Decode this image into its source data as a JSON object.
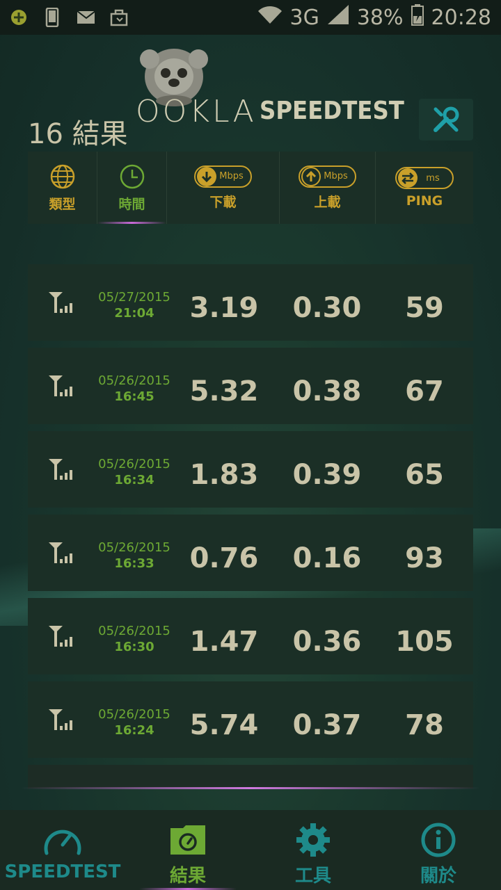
{
  "status_bar": {
    "network": "3G",
    "battery": "38%",
    "time": "20:28"
  },
  "header": {
    "brand": "OOKLA",
    "product": "SPEEDTEST",
    "results_title": "16 結果"
  },
  "sort_header": {
    "type_label": "類型",
    "time_label": "時間",
    "download_label": "下載",
    "download_unit": "Mbps",
    "upload_label": "上載",
    "upload_unit": "Mbps",
    "ping_label": "PING",
    "ping_unit": "ms",
    "active": "time"
  },
  "results": [
    {
      "date": "05/27/2015",
      "time": "21:04",
      "download": "3.19",
      "upload": "0.30",
      "ping": "59"
    },
    {
      "date": "05/26/2015",
      "time": "16:45",
      "download": "5.32",
      "upload": "0.38",
      "ping": "67"
    },
    {
      "date": "05/26/2015",
      "time": "16:34",
      "download": "1.83",
      "upload": "0.39",
      "ping": "65"
    },
    {
      "date": "05/26/2015",
      "time": "16:33",
      "download": "0.76",
      "upload": "0.16",
      "ping": "93"
    },
    {
      "date": "05/26/2015",
      "time": "16:30",
      "download": "1.47",
      "upload": "0.36",
      "ping": "105"
    },
    {
      "date": "05/26/2015",
      "time": "16:24",
      "download": "5.74",
      "upload": "0.37",
      "ping": "78"
    }
  ],
  "bottom_nav": {
    "speedtest": "SPEEDTEST",
    "results": "結果",
    "tools": "工具",
    "about": "關於"
  },
  "colors": {
    "accent_green": "#6da934",
    "accent_gold": "#c9a02a",
    "nav_teal": "#1e8a8a"
  }
}
